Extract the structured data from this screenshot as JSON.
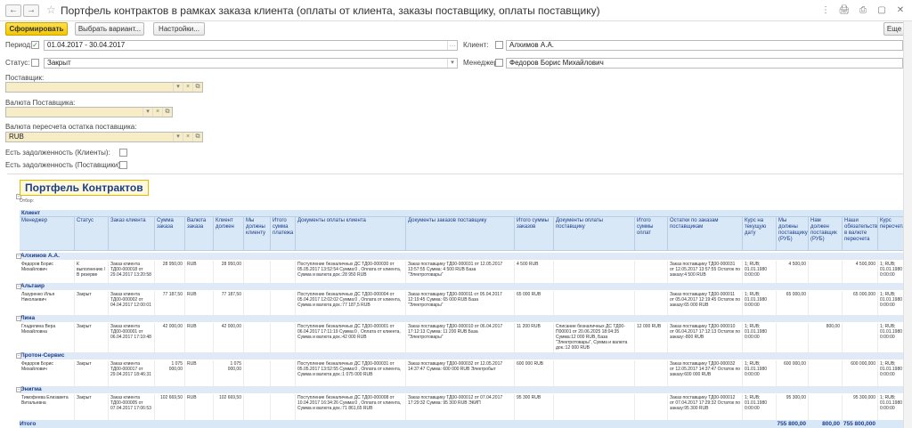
{
  "window": {
    "title": "Портфель контрактов в рамках заказа клиента (оплаты от клиента, заказы поставщику, оплаты поставщику)",
    "back": "←",
    "forward": "→",
    "star": "☆",
    "icons": [
      "⋮",
      "🖨",
      "⎙",
      "▢",
      "✕"
    ]
  },
  "toolbar": {
    "run": "Сформировать",
    "variant": "Выбрать вариант...",
    "settings": "Настройки...",
    "more": "Еще"
  },
  "filters": {
    "period_label": "Период:",
    "period_value": "01.04.2017 - 30.04.2017",
    "client_label": "Клиент:",
    "client_value": "Алхимов А.А.",
    "status_label": "Статус:",
    "status_value": "Закрыт",
    "manager_label": "Менеджер:",
    "manager_value": "Федоров Борис Михайлович",
    "supplier_label": "Поставщик:",
    "supplier_value": "",
    "supplier_currency_label": "Валюта Поставщика:",
    "supplier_currency_value": "",
    "recalc_currency_label": "Валюта пересчета остатка поставщика:",
    "recalc_currency_value": "RUB",
    "debt_clients_label": "Есть задолженность (Клиенты):",
    "debt_suppliers_label": "Есть задолженность (Поставщики):"
  },
  "report": {
    "title": "Портфель Контрактов",
    "otbor": "Отбор:",
    "header_client": "Клиент",
    "columns": [
      "Менеджер",
      "Статус",
      "Заказ клиента",
      "Сумма заказа",
      "Валюта заказа",
      "Клиент должен",
      "Мы должны клиенту",
      "Итого сумма платежа",
      "Документы оплаты клиента",
      "Документы заказов поставщику",
      "Итого суммы заказов",
      "Документы оплаты поставщику",
      "Итого суммы оплат",
      "Остатки по заказам поставщикам",
      "Курс на текущую дату",
      "Мы должны поставщику (РУБ)",
      "Нам должен поставщик (РУБ)",
      "Наши обязательства в валюте пересчета",
      "Курс пересчета"
    ],
    "groups": [
      {
        "name": "Алхимов А.А.",
        "manager": "Федоров Борис Михайлович",
        "status": "К выполнению / В резерве",
        "order": "Заказ клиента ТД00-000018 от 29.04.2017 13:20:58",
        "sum": "28 950,00",
        "currency": "RUB",
        "client_owes": "28 950,00",
        "we_owe": "",
        "paid": "",
        "pay_docs": "Поступление безналичных ДС ТД00-000030 от 05.05.2017 13:52:54 Сумма:0 , Оплата от клиента, Сумма и валюта док.:28 950 RUB",
        "supplier_orders": "Заказ поставщику ТД00-000031 от 12.05.2017 13:57:55 Сумма: 4 500 RUB База \"Электротовары\"",
        "orders_total": "4 500 RUB",
        "supplier_pay_docs": "",
        "pays_total": "",
        "remains": "Заказ поставщику ТД00-000031 от 12.05.2017 13:57:55 Остаток по заказу:4 500 RUB",
        "rate": "1; RUB; 01.01.1980 0:00:00",
        "we_owe_supplier": "4 500,00",
        "supplier_owes": "",
        "obligations": "4 500,000",
        "recalc_rate": "1; RUB; 01.01.1980 0:00:00"
      },
      {
        "name": "Альтаир",
        "manager": "Лазуренко Илья Николаевич",
        "status": "Закрыт",
        "order": "Заказ клиента ТД00-000002 от 04.04.2017 12:00:01",
        "sum": "77 187,50",
        "currency": "RUB",
        "client_owes": "77 187,50",
        "we_owe": "",
        "paid": "",
        "pay_docs": "Поступление безналичных ДС ТД00-000004 от 05.04.2017 12:02:02 Сумма:0 , Оплата от клиента, Сумма и валюта док.:77 187,5 RUB",
        "supplier_orders": "Заказ поставщику ТД00-000011 от 05.04.2017 12:19:45 Сумма: 65 000 RUB База \"Электротовары\"",
        "orders_total": "65 000 RUB",
        "supplier_pay_docs": "",
        "pays_total": "",
        "remains": "Заказ поставщику ТД00-000011 от 05.04.2017 12:19:45 Остаток по заказу:65 000 RUB",
        "rate": "1; RUB; 01.01.1980 0:00:00",
        "we_owe_supplier": "65 000,00",
        "supplier_owes": "",
        "obligations": "65 000,000",
        "recalc_rate": "1; RUB; 01.01.1980 0:00:00"
      },
      {
        "name": "Лина",
        "manager": "Гладилина Вера Михайловна",
        "status": "Закрыт",
        "order": "Заказ клиента ТД00-000001 от 06.04.2017 17:10:48",
        "sum": "42 000,00",
        "currency": "RUB",
        "client_owes": "42 000,00",
        "we_owe": "",
        "paid": "",
        "pay_docs": "Поступление безналичных ДС ТД00-000001 от 06.04.2017 17:11:19 Сумма:0 , Оплата от клиента, Сумма и валюта док.:42 000 RUB",
        "supplier_orders": "Заказ поставщику ТД00-000010 от 06.04.2017 17:12:13 Сумма: 11 200 RUB База \"Электротовары\"",
        "orders_total": "11 200 RUB",
        "supplier_pay_docs": "Списание безналичных ДС ТД00-П00001 от 20.06.2025 18:04:35 Сумма:12 000 RUB, База \"Электротовары\", Сумма и валюта док.:12 000 RUB",
        "pays_total": "12 000 RUB",
        "remains": "Заказ поставщику ТД00-000010 от 06.04.2017 17:12:13 Остаток по заказу:-800 RUB",
        "rate": "1; RUB; 01.01.1980 0:00:00",
        "we_owe_supplier": "",
        "supplier_owes": "800,00",
        "obligations": "",
        "recalc_rate": "1; RUB; 01.01.1980 0:00:00"
      },
      {
        "name": "Протон-Сервис",
        "manager": "Федоров Борис Михайлович",
        "status": "Закрыт",
        "order": "Заказ клиента ТД00-000017 от 29.04.2017 18:46:31",
        "sum": "1 075 000,00",
        "currency": "RUB",
        "client_owes": "1 075 000,00",
        "we_owe": "",
        "paid": "",
        "pay_docs": "Поступление безналичных ДС ТД00-000031 от 05.05.2017 13:52:55 Сумма:0 , Оплата от клиента, Сумма и валюта док.:1 075 000 RUB",
        "supplier_orders": "Заказ поставщику ТД00-000032 от 12.05.2017 14:37:47 Сумма: 600 000 RUB Электробыт",
        "orders_total": "600 000 RUB",
        "supplier_pay_docs": "",
        "pays_total": "",
        "remains": "Заказ поставщику ТД00-000032 от 12.05.2017 14:37:47 Остаток по заказу:600 000 RUB",
        "rate": "1; RUB; 01.01.1980 0:00:00",
        "we_owe_supplier": "600 000,00",
        "supplier_owes": "",
        "obligations": "600 000,000",
        "recalc_rate": "1; RUB; 01.01.1980 0:00:00"
      },
      {
        "name": "Энигма",
        "manager": "Тимофеева Елизавета Витальевна",
        "status": "Закрыт",
        "order": "Заказ клиента ТД00-000005 от 07.04.2017 17:06:53",
        "sum": "102 669,50",
        "currency": "RUB",
        "client_owes": "102 669,50",
        "we_owe": "",
        "paid": "",
        "pay_docs": "Поступление безналичных ДС ТД00-000008 от 10.04.2017 16:34:26 Сумма:0 , Оплата от клиента, Сумма и валюта док.:71 861,65 RUB",
        "supplier_orders": "Заказ поставщику ТД00-000012 от 07.04.2017 17:29:32 Сумма: 95 300 RUB ЭКИП",
        "orders_total": "95 300 RUB",
        "supplier_pay_docs": "",
        "pays_total": "",
        "remains": "Заказ поставщику ТД00-000012 от 07.04.2017 17:29:32 Остаток по заказу:95 300 RUB",
        "rate": "1; RUB; 01.01.1980 0:00:00",
        "we_owe_supplier": "95 300,00",
        "supplier_owes": "",
        "obligations": "95 300,000",
        "recalc_rate": "1; RUB; 01.01.1980 0:00:00"
      }
    ],
    "total_label": "Итого",
    "total_we_owe_supplier": "755 800,00",
    "total_supplier_owes": "800,00",
    "total_obligations": "755 800,000"
  }
}
